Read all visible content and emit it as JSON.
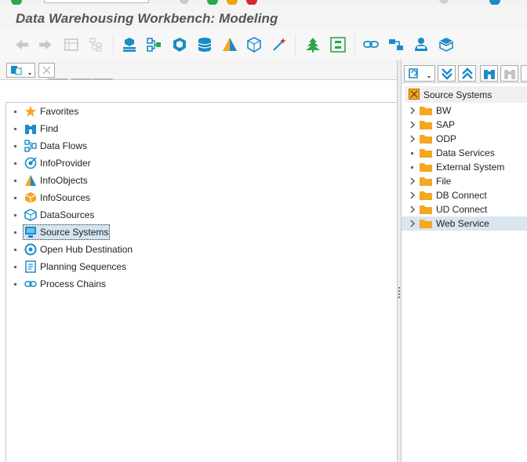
{
  "window": {
    "title": "Data Warehousing Workbench: Modeling"
  },
  "colors": {
    "accent_blue": "#1a8bc7",
    "folder": "#f5a623",
    "selection": "#d4e4f1"
  },
  "toolbar": {
    "icons": [
      "back-arrow-icon",
      "forward-arrow-icon",
      "table-icon",
      "hierarchy-icon",
      "cube-stack-icon",
      "dataflow-icon",
      "infocube-icon",
      "database-icon",
      "infoobject-icon",
      "datasource-icon",
      "wand-icon",
      "tree-icon",
      "object-group-icon",
      "link-icon",
      "transport-icon",
      "user-icon",
      "package-icon"
    ]
  },
  "left_navigation": {
    "items": [
      {
        "label": "Favorites",
        "icon": "star-icon"
      },
      {
        "label": "Find",
        "icon": "binoculars-icon"
      },
      {
        "label": "Data Flows",
        "icon": "dataflow-icon"
      },
      {
        "label": "InfoProvider",
        "icon": "infoprovider-icon"
      },
      {
        "label": "InfoObjects",
        "icon": "infoobject-icon"
      },
      {
        "label": "InfoSources",
        "icon": "infosource-icon"
      },
      {
        "label": "DataSources",
        "icon": "datasource-icon"
      },
      {
        "label": "Source Systems",
        "icon": "monitor-icon",
        "selected": true
      },
      {
        "label": "Open Hub Destination",
        "icon": "target-icon"
      },
      {
        "label": "Planning Sequences",
        "icon": "planning-icon"
      },
      {
        "label": "Process Chains",
        "icon": "chain-icon"
      }
    ]
  },
  "right_panel": {
    "header": "Source Systems",
    "items": [
      {
        "label": "BW",
        "expandable": true
      },
      {
        "label": "SAP",
        "expandable": true
      },
      {
        "label": "ODP",
        "expandable": true
      },
      {
        "label": "Data Services",
        "expandable": false
      },
      {
        "label": "External System",
        "expandable": false
      },
      {
        "label": "File",
        "expandable": true
      },
      {
        "label": "DB Connect",
        "expandable": true
      },
      {
        "label": "UD Connect",
        "expandable": true
      },
      {
        "label": "Web Service",
        "expandable": true,
        "selected": true
      }
    ]
  }
}
